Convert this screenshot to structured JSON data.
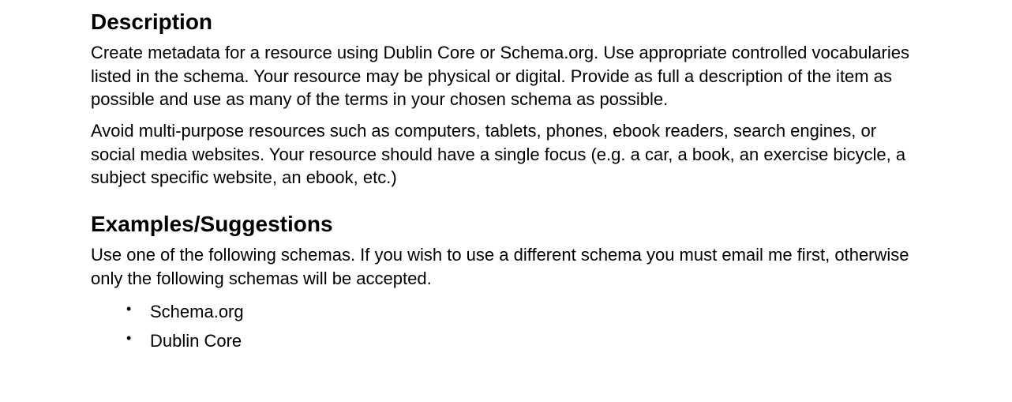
{
  "sections": {
    "description": {
      "heading": "Description",
      "paragraphs": [
        "Create metadata for a resource using Dublin Core or Schema.org. Use appropriate controlled vocabularies listed in the schema. Your resource may be physical or digital. Provide as full a description of the item as possible and use as many of the terms in your chosen schema as possible.",
        "Avoid multi-purpose resources such as computers, tablets, phones, ebook readers, search engines, or social media websites. Your resource should have a single focus (e.g. a car, a book, an exercise bicycle, a subject specific website, an ebook, etc.)"
      ]
    },
    "examples": {
      "heading": "Examples/Suggestions",
      "intro": "Use one of the following schemas. If you wish to use a different schema you must email me first, otherwise only the following schemas will be accepted.",
      "items": [
        "Schema.org",
        "Dublin Core"
      ]
    }
  }
}
